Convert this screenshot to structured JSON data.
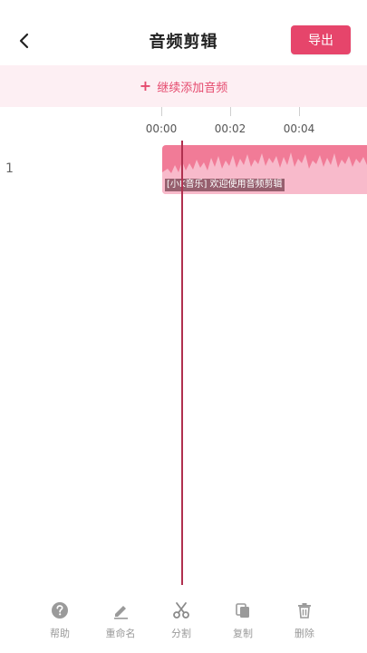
{
  "header": {
    "title": "音频剪辑",
    "export_label": "导出"
  },
  "add_audio": {
    "plus": "+",
    "label": "继续添加音频"
  },
  "timeline": {
    "ticks": [
      "00:00",
      "00:02",
      "00:04"
    ]
  },
  "track": {
    "index": "1",
    "clip_label": "[小K音乐] 欢迎使用音频剪辑"
  },
  "toolbar": {
    "items": [
      {
        "label": "帮助",
        "icon": "help-icon"
      },
      {
        "label": "重命名",
        "icon": "edit-icon"
      },
      {
        "label": "分割",
        "icon": "scissors-icon"
      },
      {
        "label": "复制",
        "icon": "copy-icon"
      },
      {
        "label": "删除",
        "icon": "trash-icon"
      }
    ]
  },
  "colors": {
    "accent": "#e6456b",
    "band": "#fdeff3",
    "clip": "#f17b97",
    "playhead": "#b0304f"
  }
}
